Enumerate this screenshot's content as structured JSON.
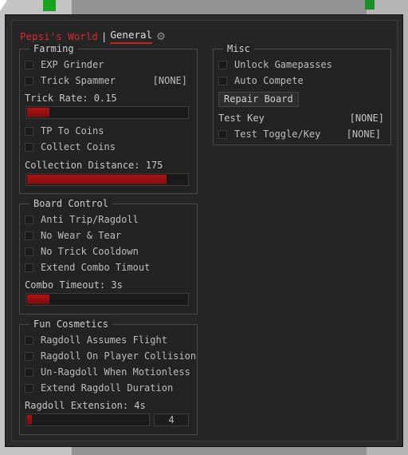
{
  "tabs": {
    "active_label": "Pepsi's World",
    "separator": "|",
    "general_label": "General"
  },
  "accent_color": "#c42121",
  "farming": {
    "title": "Farming",
    "exp_grinder": "EXP Grinder",
    "trick_spammer": "Trick Spammer",
    "trick_spammer_key": "[NONE]",
    "trick_rate_label": "Trick Rate: 0.15",
    "trick_rate_fraction": 0.15,
    "tp_to_coins": "TP To Coins",
    "collect_coins": "Collect Coins",
    "collection_distance_label": "Collection Distance: 175",
    "collection_distance_fraction": 0.87
  },
  "board_control": {
    "title": "Board Control",
    "anti_trip": "Anti Trip/Ragdoll",
    "no_wear": "No Wear & Tear",
    "no_trick_cooldown": "No Trick Cooldown",
    "extend_combo": "Extend Combo Timout",
    "combo_timeout_label": "Combo Timeout: 3s",
    "combo_timeout_fraction": 0.15
  },
  "fun_cosmetics": {
    "title": "Fun Cosmetics",
    "ragdoll_flight": "Ragdoll Assumes Flight",
    "ragdoll_collision": "Ragdoll On Player Collision",
    "unragdoll_motionless": "Un-Ragdoll When Motionless",
    "extend_ragdoll": "Extend Ragdoll Duration",
    "ragdoll_extension_label": "Ragdoll Extension: 4s",
    "ragdoll_extension_value": "4",
    "ragdoll_extension_fraction": 0.05
  },
  "misc": {
    "title": "Misc",
    "unlock_gamepasses": "Unlock Gamepasses",
    "auto_compete": "Auto Compete",
    "repair_board": "Repair Board",
    "test_key_label": "Test Key",
    "test_key_value": "[NONE]",
    "test_toggle_label": "Test Toggle/Key",
    "test_toggle_value": "[NONE]"
  }
}
